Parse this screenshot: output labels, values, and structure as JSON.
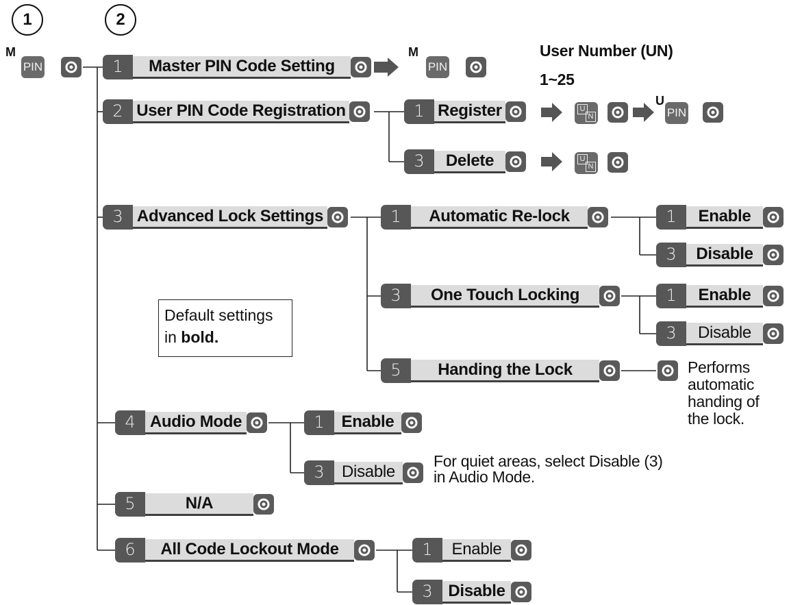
{
  "steps": {
    "step1": "1",
    "step2": "2"
  },
  "keys": {
    "pin": "PIN",
    "m": "M",
    "u": "U",
    "un_u": "U",
    "un_n": "N"
  },
  "top_labels": {
    "user_number": "User Number (UN)",
    "range": "1~25"
  },
  "menu": {
    "master_pin": {
      "num": "1",
      "label": "Master PIN Code Setting"
    },
    "user_pin": {
      "num": "2",
      "label": "User PIN Code Registration"
    },
    "register": {
      "num": "1",
      "label": "Register"
    },
    "delete": {
      "num": "3",
      "label": "Delete"
    },
    "advanced": {
      "num": "3",
      "label": "Advanced Lock Settings"
    },
    "auto_relock": {
      "num": "1",
      "label": "Automatic Re-lock"
    },
    "auto_relock_enable": {
      "num": "1",
      "label": "Enable"
    },
    "auto_relock_disable": {
      "num": "3",
      "label": "Disable"
    },
    "one_touch": {
      "num": "3",
      "label": "One Touch Locking"
    },
    "one_touch_enable": {
      "num": "1",
      "label": "Enable"
    },
    "one_touch_disable": {
      "num": "3",
      "label": "Disable"
    },
    "handing": {
      "num": "5",
      "label": "Handing the Lock"
    },
    "audio": {
      "num": "4",
      "label": "Audio Mode"
    },
    "audio_enable": {
      "num": "1",
      "label": "Enable"
    },
    "audio_disable": {
      "num": "3",
      "label": "Disable"
    },
    "na": {
      "num": "5",
      "label": "N/A"
    },
    "lockout": {
      "num": "6",
      "label": "All Code Lockout Mode"
    },
    "lockout_enable": {
      "num": "1",
      "label": "Enable"
    },
    "lockout_disable": {
      "num": "3",
      "label": "Disable"
    }
  },
  "notes": {
    "handing": [
      "Performs",
      "automatic",
      "handing of",
      "the lock."
    ],
    "audio": [
      "For quiet areas, select Disable (3)",
      "in  Audio Mode."
    ]
  },
  "legend": {
    "line1": "Default settings",
    "line2_prefix": "in ",
    "line2_bold": "bold."
  },
  "colors": {
    "tab": "#575757",
    "label_bg": "#dcdcdc",
    "key": "#6a6a6a",
    "line": "#222222"
  }
}
